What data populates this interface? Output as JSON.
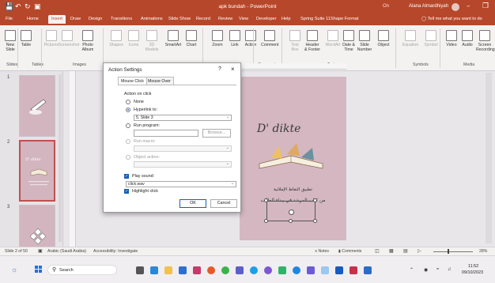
{
  "window": {
    "title": "apk bundah - PowerPoint",
    "account": "Alana Almardhiyah",
    "doc_status": "On"
  },
  "tabs": [
    "File",
    "Home",
    "Insert",
    "Draw",
    "Design",
    "Transitions",
    "Animations",
    "Slide Show",
    "Record",
    "Review",
    "View",
    "Developer",
    "Help",
    "Spring Suite 11",
    "Shape Format"
  ],
  "active_tab": "Insert",
  "tell_me": "Tell me what you want to do",
  "ribbon": {
    "buttons": [
      {
        "label": "New\nSlide",
        "name": "new-slide-button"
      },
      {
        "label": "Table",
        "name": "table-button"
      },
      {
        "label": "Pictures",
        "name": "pictures-button",
        "dim": true
      },
      {
        "label": "Screenshot",
        "name": "screenshot-button",
        "dim": true
      },
      {
        "label": "Photo\nAlbum",
        "name": "photo-album-button"
      },
      {
        "label": "Shapes",
        "name": "shapes-button",
        "dim": true
      },
      {
        "label": "Icons",
        "name": "icons-button",
        "dim": true
      },
      {
        "label": "3D\nModels",
        "name": "3d-models-button",
        "dim": true
      },
      {
        "label": "SmartArt",
        "name": "smartart-button"
      },
      {
        "label": "Chart",
        "name": "chart-button"
      },
      {
        "label": "Zoom",
        "name": "zoom-button"
      },
      {
        "label": "Link",
        "name": "link-button"
      },
      {
        "label": "Action",
        "name": "action-button"
      },
      {
        "label": "Comment",
        "name": "comment-button"
      },
      {
        "label": "Text\nBox",
        "name": "text-box-button",
        "dim": true
      },
      {
        "label": "Header\n& Footer",
        "name": "header-footer-button"
      },
      {
        "label": "WordArt",
        "name": "wordart-button",
        "dim": true
      },
      {
        "label": "Date &\nTime",
        "name": "date-time-button"
      },
      {
        "label": "Slide\nNumber",
        "name": "slide-number-button"
      },
      {
        "label": "Object",
        "name": "object-button"
      },
      {
        "label": "Equation",
        "name": "equation-button",
        "dim": true
      },
      {
        "label": "Symbol",
        "name": "symbol-button",
        "dim": true
      },
      {
        "label": "Video",
        "name": "video-button"
      },
      {
        "label": "Audio",
        "name": "audio-button"
      },
      {
        "label": "Screen\nRecording",
        "name": "screen-recording-button"
      }
    ],
    "groups": [
      "Slides",
      "Tables",
      "Images",
      "Illustrations",
      "Links",
      "Comments",
      "Text",
      "Symbols",
      "Media"
    ]
  },
  "thumbnails": [
    {
      "num": "1",
      "title": ""
    },
    {
      "num": "2",
      "title": "D' dikte",
      "selected": true
    },
    {
      "num": "3",
      "title": ""
    }
  ],
  "slide": {
    "title": "D' dikte",
    "arabic_line1": "تطبيق النقاط الإملائية",
    "arabic_line2": "من كتاب المرشد في بيداء الطالب",
    "bg_color": "#d4b7c1"
  },
  "dialog": {
    "title": "Action Settings",
    "help": "?",
    "tabs": [
      "Mouse Click",
      "Mouse Over"
    ],
    "section": "Action on click",
    "options": {
      "none": "None",
      "hyperlink": "Hyperlink to:",
      "hyperlink_value": "5. Slide 3",
      "run_program": "Run program:",
      "browse": "Browse...",
      "run_macro": "Run macro:",
      "object_action": "Object action:"
    },
    "play_sound": "Play sound:",
    "sound_value": "click.wav",
    "highlight": "Highlight click",
    "ok": "OK",
    "cancel": "Cancel"
  },
  "status": {
    "slide_info": "Slide 2 of 50",
    "language": "Arabic (Saudi Arabia)",
    "accessibility": "Accessibility: Investigate",
    "notes": "Notes",
    "comments": "Comments",
    "zoom": "28%"
  },
  "taskbar": {
    "search": "Search",
    "time": "11:52",
    "date": "09/10/2023"
  },
  "colors": {
    "accent": "#b7472a",
    "link_blue": "#1a5fb4"
  }
}
